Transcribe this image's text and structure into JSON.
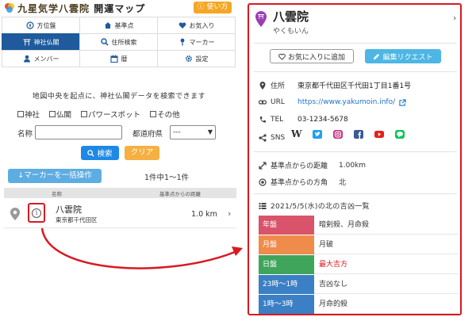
{
  "app": {
    "title_main": "九星気学八雲院",
    "title_sub": "開運マップ",
    "usage_label": "使い方"
  },
  "nav": {
    "items": [
      {
        "label": "方位盤",
        "icon": "compass-icon",
        "active": false
      },
      {
        "label": "基準点",
        "icon": "home-icon",
        "active": false
      },
      {
        "label": "お気入り",
        "icon": "heart-icon",
        "active": false
      },
      {
        "label": "神社仏閣",
        "icon": "torii-icon",
        "active": true
      },
      {
        "label": "住所検索",
        "icon": "search-icon",
        "active": false
      },
      {
        "label": "マーカー",
        "icon": "marker-icon",
        "active": false
      },
      {
        "label": "メンバー",
        "icon": "user-icon",
        "active": false
      },
      {
        "label": "暦",
        "icon": "calendar-icon",
        "active": false
      },
      {
        "label": "設定",
        "icon": "gear-icon",
        "active": false
      }
    ]
  },
  "search": {
    "description": "地図中央を起点に、神社仏閣データを検索できます",
    "categories": [
      "神社",
      "仏閣",
      "パワースポット",
      "その他"
    ],
    "name_label": "名称",
    "name_value": "",
    "pref_label": "都道府県",
    "pref_value": "---",
    "search_button": "検索",
    "clear_button": "クリア"
  },
  "results": {
    "bulk_button": "↓マーカーを一括操作",
    "count": "1件中1〜1件",
    "col_name": "名称",
    "col_distance": "基準点からの距離",
    "rows": [
      {
        "name": "八雲院",
        "address": "東京都千代田区",
        "distance": "1.0 km"
      }
    ]
  },
  "detail": {
    "title": "八雲院",
    "reading": "やくもいん",
    "favorite_button": "お気に入りに追加",
    "edit_button": "編集リクエスト",
    "address_label": "住所",
    "address_value": "東京都千代田区千代田1丁目1番1号",
    "url_label": "URL",
    "url_value": "https://www.yakumoin.info/",
    "tel_label": "TEL",
    "tel_value": "03-1234-5678",
    "sns_label": "SNS",
    "sns_icons": [
      "wordpress-icon",
      "twitter-icon",
      "instagram-icon",
      "facebook-icon",
      "youtube-icon",
      "line-icon"
    ],
    "distance_label": "基準点からの距離",
    "distance_value": "1.00km",
    "direction_label": "基準点からの方角",
    "direction_value": "北",
    "table_title": "2021/5/5(水)の北の吉凶一覧",
    "table": [
      {
        "key": "年盤",
        "value": "暗剣殺、月命殺",
        "key_color": "#d9536a",
        "value_color": "#333333"
      },
      {
        "key": "月盤",
        "value": "月破",
        "key_color": "#ef8b4b",
        "value_color": "#333333"
      },
      {
        "key": "日盤",
        "value": "最大吉方",
        "key_color": "#3fa55b",
        "value_color": "#d9191f"
      },
      {
        "key": "23時〜1時",
        "value": "吉凶なし",
        "key_color": "#3b7fc4",
        "value_color": "#333333"
      },
      {
        "key": "1時〜3時",
        "value": "月命的殺",
        "key_color": "#3b7fc4",
        "value_color": "#333333"
      }
    ]
  },
  "colors": {
    "accent_red": "#d9191f",
    "nav_active": "#1e5a9c",
    "search_blue": "#1e88e5",
    "clear_orange": "#f5b041",
    "usage_orange": "#f5a623",
    "link_blue": "#1a73c7",
    "pin_purple": "#9b3fb5"
  }
}
